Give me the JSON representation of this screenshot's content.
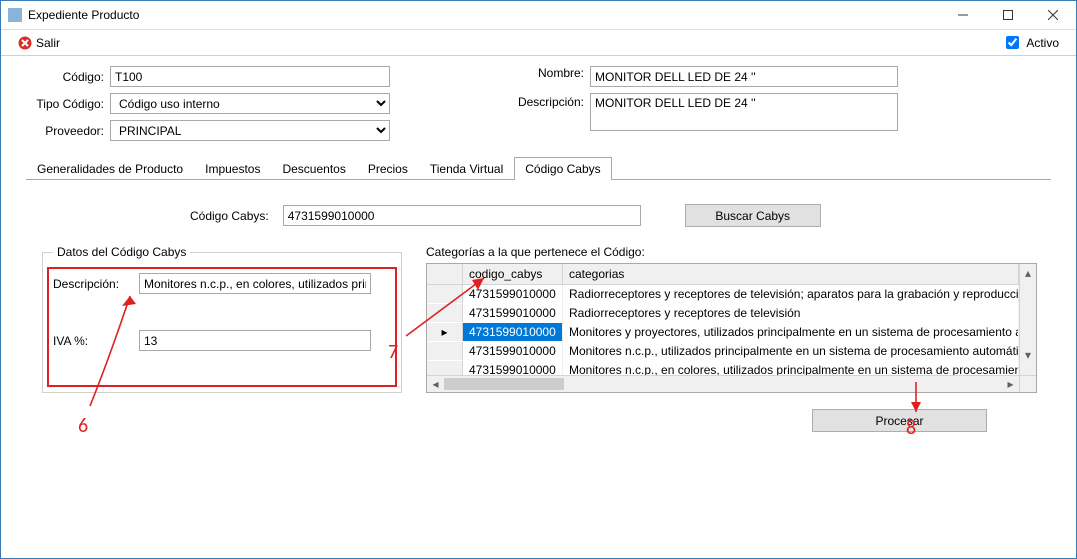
{
  "window": {
    "title": "Expediente Producto"
  },
  "toolbar": {
    "salir": "Salir",
    "activo": "Activo",
    "activo_checked": true
  },
  "form": {
    "codigo_label": "Código:",
    "codigo_value": "T100",
    "tipocodigo_label": "Tipo Código:",
    "tipocodigo_value": "Código uso interno",
    "proveedor_label": "Proveedor:",
    "proveedor_value": "PRINCIPAL",
    "nombre_label": "Nombre:",
    "nombre_value": "MONITOR DELL LED DE 24 ''",
    "descripcion_label": "Descripción:",
    "descripcion_value": "MONITOR DELL LED DE 24 ''"
  },
  "tabs": {
    "items": [
      "Generalidades de Producto",
      "Impuestos",
      "Descuentos",
      "Precios",
      "Tienda Virtual",
      "Código Cabys"
    ],
    "active_index": 5
  },
  "cabys": {
    "code_label": "Código Cabys:",
    "code_value": "4731599010000",
    "buscar_label": "Buscar Cabys",
    "datos_legend": "Datos del Código Cabys",
    "descripcion_label": "Descripción:",
    "descripcion_value": "Monitores n.c.p., en colores, utilizados principalme",
    "iva_label": "IVA %:",
    "iva_value": "13",
    "cats_label": "Categorías a la que pertenece el Código:",
    "cols": {
      "code": "codigo_cabys",
      "cat": "categorias"
    },
    "rows": [
      {
        "code": "4731599010000",
        "cat": "Radiorreceptores y receptores de televisión; aparatos para la grabación y reproducción",
        "selected": false,
        "current": false
      },
      {
        "code": "4731599010000",
        "cat": "Radiorreceptores y receptores de televisión",
        "selected": false,
        "current": false
      },
      {
        "code": "4731599010000",
        "cat": "Monitores y proyectores, utilizados principalmente en un sistema de procesamiento aut",
        "selected": true,
        "current": true
      },
      {
        "code": "4731599010000",
        "cat": "Monitores n.c.p., utilizados principalmente en un sistema de procesamiento automático",
        "selected": false,
        "current": false
      },
      {
        "code": "4731599010000",
        "cat": "Monitores n.c.p., en colores, utilizados principalmente en un sistema de procesamiento",
        "selected": false,
        "current": false
      }
    ],
    "procesar_label": "Procesar"
  },
  "annotations": {
    "a6": "6",
    "a7": "7",
    "a8": "8"
  }
}
